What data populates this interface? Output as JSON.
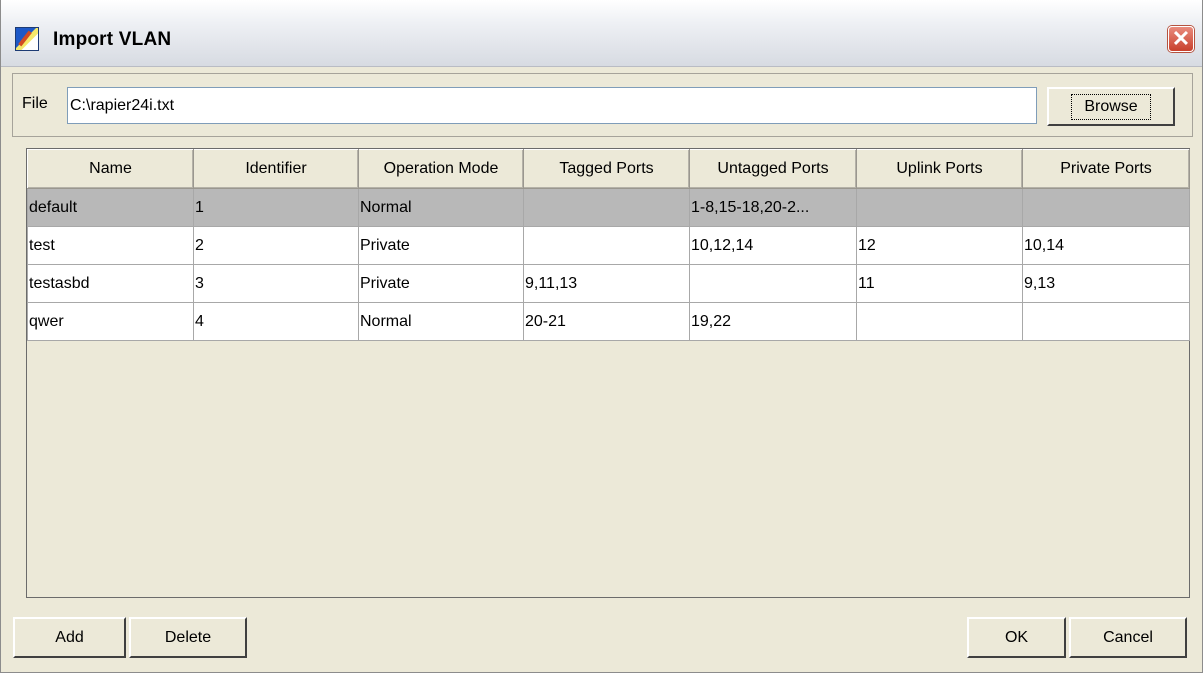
{
  "window": {
    "title": "Import VLAN"
  },
  "file": {
    "label": "File",
    "value": "C:\\rapier24i.txt",
    "browse_label": "Browse"
  },
  "table": {
    "columns": [
      "Name",
      "Identifier",
      "Operation Mode",
      "Tagged Ports",
      "Untagged Ports",
      "Uplink Ports",
      "Private Ports"
    ],
    "rows": [
      [
        "default",
        "1",
        "Normal",
        "",
        "1-8,15-18,20-2...",
        "",
        ""
      ],
      [
        "test",
        "2",
        "Private",
        "",
        "10,12,14",
        "12",
        "10,14"
      ],
      [
        "testasbd",
        "3",
        "Private",
        "9,11,13",
        "",
        "11",
        "9,13"
      ],
      [
        "qwer",
        "4",
        "Normal",
        "20-21",
        "19,22",
        "",
        ""
      ]
    ],
    "selected_row": 0
  },
  "buttons": {
    "add": "Add",
    "delete": "Delete",
    "ok": "OK",
    "cancel": "Cancel"
  },
  "icons": {
    "app": "vlan-import-icon",
    "close": "close-icon"
  },
  "colors": {
    "close_button": "#c8402c",
    "selected_row": "#b8b8b8",
    "dialog_bg": "#ece9d8"
  }
}
